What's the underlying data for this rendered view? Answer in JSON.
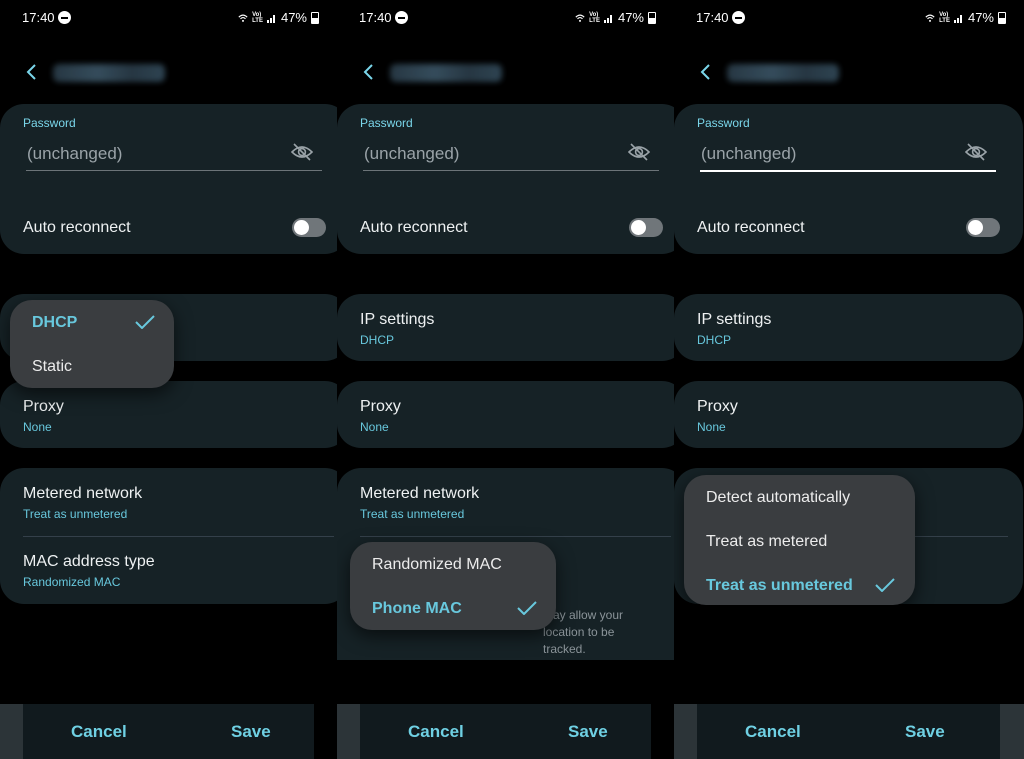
{
  "status": {
    "time": "17:40",
    "volte": "Vo)) LTE",
    "battery": "47%"
  },
  "password": {
    "label": "Password",
    "value": "(unchanged)"
  },
  "auto_reconnect": {
    "label": "Auto reconnect"
  },
  "ip_settings": {
    "label": "IP settings",
    "value": "DHCP"
  },
  "proxy": {
    "label": "Proxy",
    "value": "None"
  },
  "metered": {
    "label": "Metered network",
    "value": "Treat as unmetered"
  },
  "mac": {
    "label": "MAC address type",
    "value": "Randomized MAC"
  },
  "mac_note": "may allow your location to be tracked.",
  "ip_menu": {
    "options": [
      "DHCP",
      "Static"
    ],
    "selected": "DHCP"
  },
  "mac_menu": {
    "options": [
      "Randomized MAC",
      "Phone MAC"
    ],
    "selected": "Phone MAC"
  },
  "metered_menu": {
    "options": [
      "Detect automatically",
      "Treat as metered",
      "Treat as unmetered"
    ],
    "selected": "Treat as unmetered"
  },
  "buttons": {
    "cancel": "Cancel",
    "save": "Save"
  },
  "colors": {
    "accent": "#68c8dd",
    "card": "#162226",
    "popup": "#3a3d40"
  }
}
